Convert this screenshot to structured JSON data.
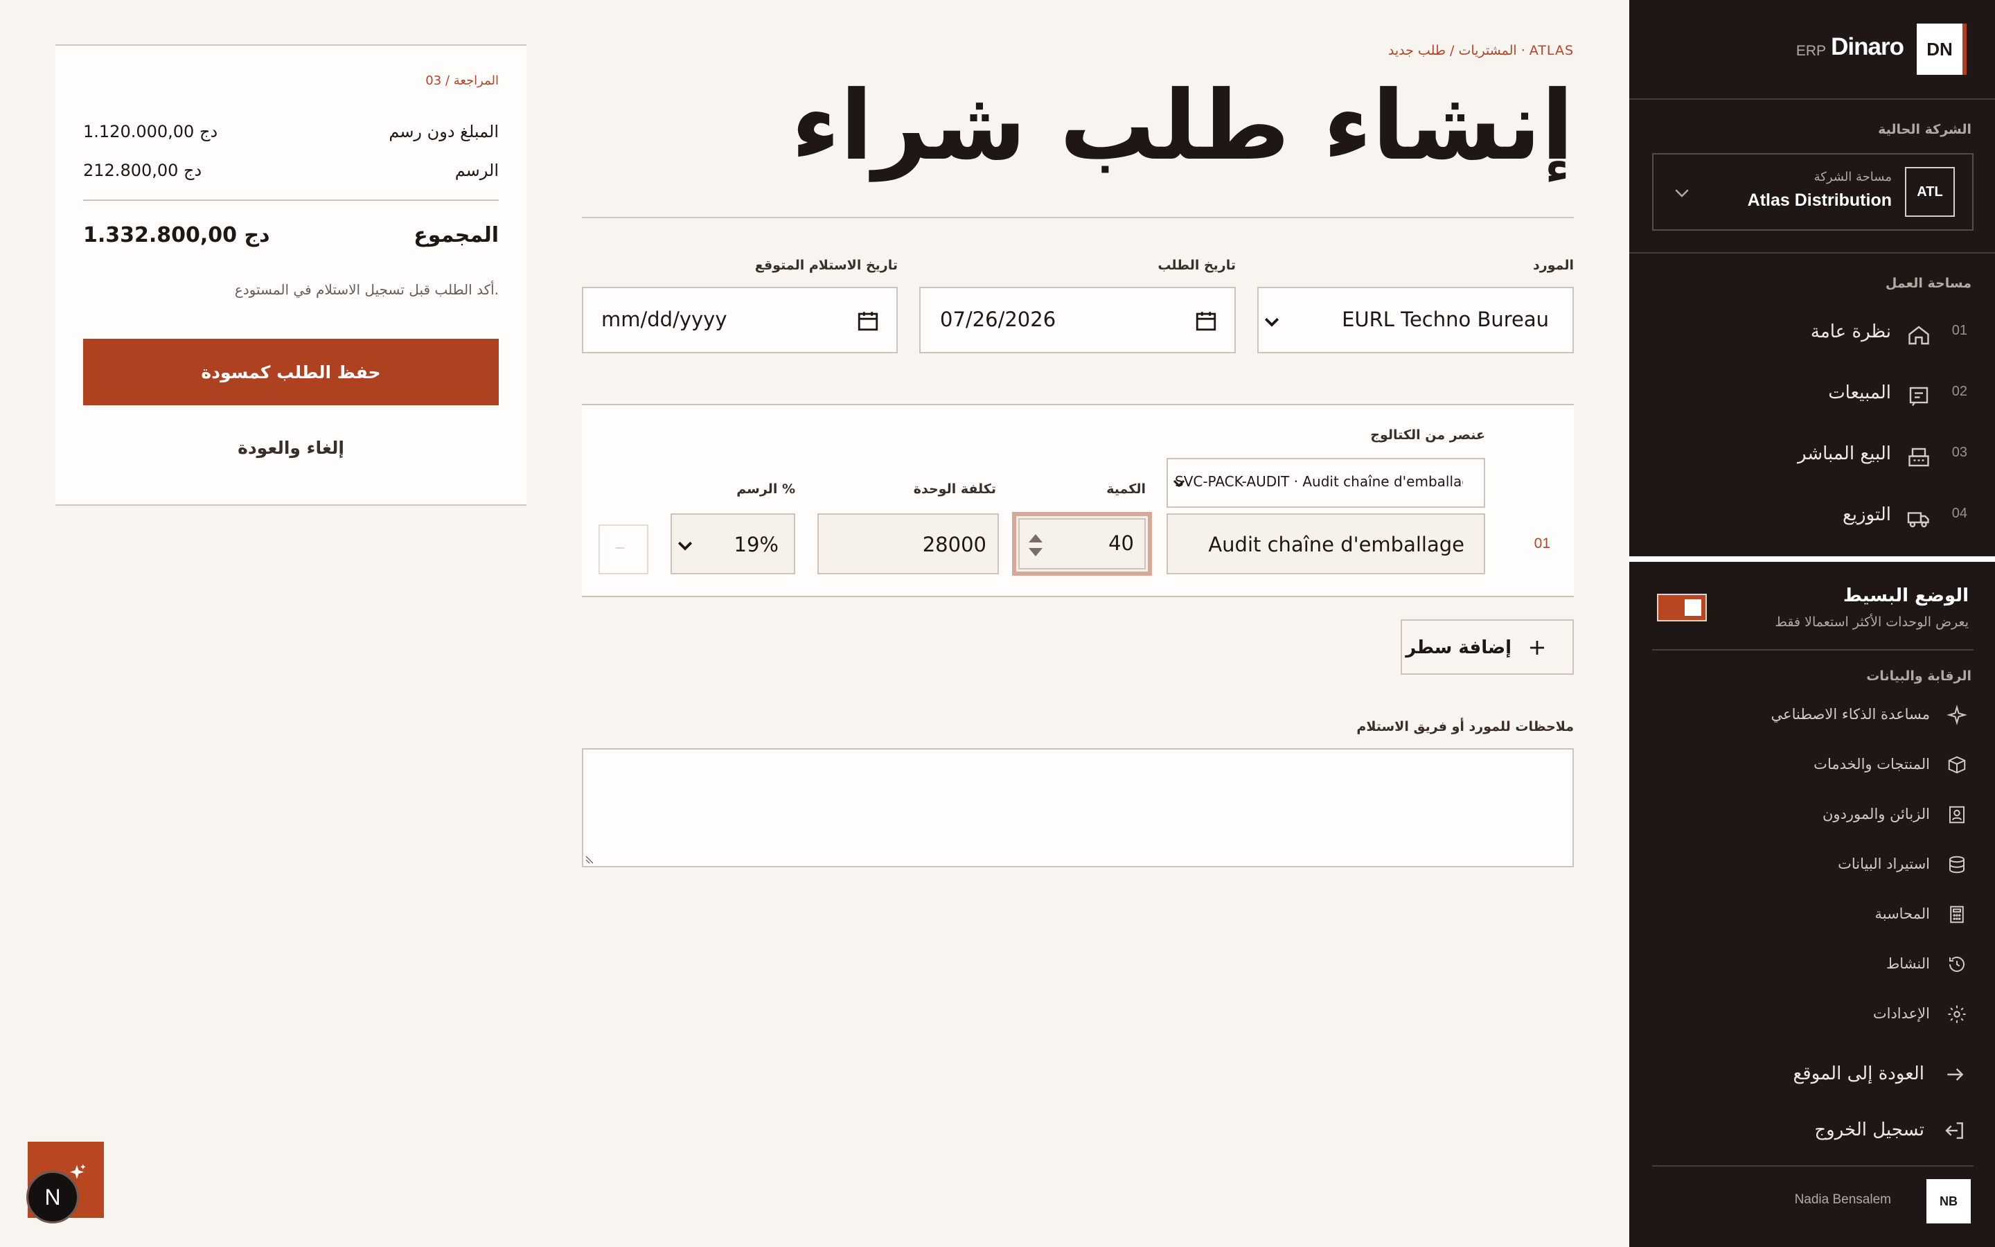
{
  "app": {
    "brand": "Dinaro",
    "brand_suffix": "ERP",
    "logo": "DN"
  },
  "sidebar": {
    "company_section_title": "الشركة الحالية",
    "company": {
      "badge": "ATL",
      "label": "مساحة الشركة",
      "name": "Atlas Distribution",
      "icon": "chevron-down-icon"
    },
    "workspace_title": "مساحة العمل",
    "nav": [
      {
        "num": "01",
        "label": "نظرة عامة",
        "icon": "home-icon"
      },
      {
        "num": "02",
        "label": "المبيعات",
        "icon": "receipt-icon"
      },
      {
        "num": "03",
        "label": "البيع المباشر",
        "icon": "cash-register-icon"
      },
      {
        "num": "04",
        "label": "التوزيع",
        "icon": "truck-icon"
      }
    ],
    "simple_mode": {
      "title": "الوضع البسيط",
      "subtitle": "يعرض الوحدات الأكثر استعمالا فقط",
      "enabled": true
    },
    "control_title": "الرقابة والبيانات",
    "control_items": [
      {
        "label": "مساعدة الذكاء الاصطناعي",
        "icon": "sparkle-icon"
      },
      {
        "label": "المنتجات والخدمات",
        "icon": "box-icon"
      },
      {
        "label": "الزبائن والموردون",
        "icon": "contact-icon"
      },
      {
        "label": "استيراد البيانات",
        "icon": "database-icon"
      },
      {
        "label": "المحاسبة",
        "icon": "calculator-icon"
      },
      {
        "label": "النشاط",
        "icon": "history-icon"
      },
      {
        "label": "الإعدادات",
        "icon": "gear-icon"
      }
    ],
    "back_to_site": "العودة إلى الموقع",
    "logout": "تسجيل الخروج",
    "user": {
      "name": "Nadia Bensalem",
      "initials": "NB"
    }
  },
  "main": {
    "breadcrumb": "المشتريات / طلب جديد · ATLAS",
    "title": "إنشاء طلب شراء",
    "supplier": {
      "label": "المورد",
      "value": "EURL Techno Bureau"
    },
    "order_date": {
      "label": "تاريخ الطلب",
      "value": "07/26/2026"
    },
    "delivery_date": {
      "label": "تاريخ الاستلام المتوقع",
      "value": "mm/dd/yyyy"
    },
    "lines": {
      "catalog_label": "عنصر من الكتالوج",
      "quantity_label": "الكمية",
      "unit_cost_label": "تكلفة الوحدة",
      "tax_label": "الرسم %",
      "rows": [
        {
          "num": "01",
          "catalog_value": "SVC-PACK-AUDIT · Audit chaîne d'emballage",
          "description": "Audit chaîne d'emballage",
          "quantity": "40",
          "unit_cost": "28000",
          "tax": "19%",
          "remove": "—"
        }
      ]
    },
    "add_line": "إضافة سطر",
    "notes_label": "ملاحظات للمورد أو فريق الاستلام",
    "notes_value": ""
  },
  "summary": {
    "step": "03 / المراجعة",
    "subtotal_label": "المبلغ دون رسم",
    "subtotal_value": "1.120.000,00 دج",
    "tax_label": "الرسم",
    "tax_value": "212.800,00 دج",
    "total_label": "المجموع",
    "total_value": "1.332.800,00 دج",
    "note": "أكد الطلب قبل تسجيل الاستلام في المستودع.",
    "save": "حفظ الطلب كمسودة",
    "cancel": "إلغاء والعودة"
  },
  "floating": {
    "avatar_letter": "N"
  },
  "colors": {
    "accent": "#ad4120",
    "sidebar_bg": "#1f1715",
    "page_bg": "#f8f5f1"
  }
}
